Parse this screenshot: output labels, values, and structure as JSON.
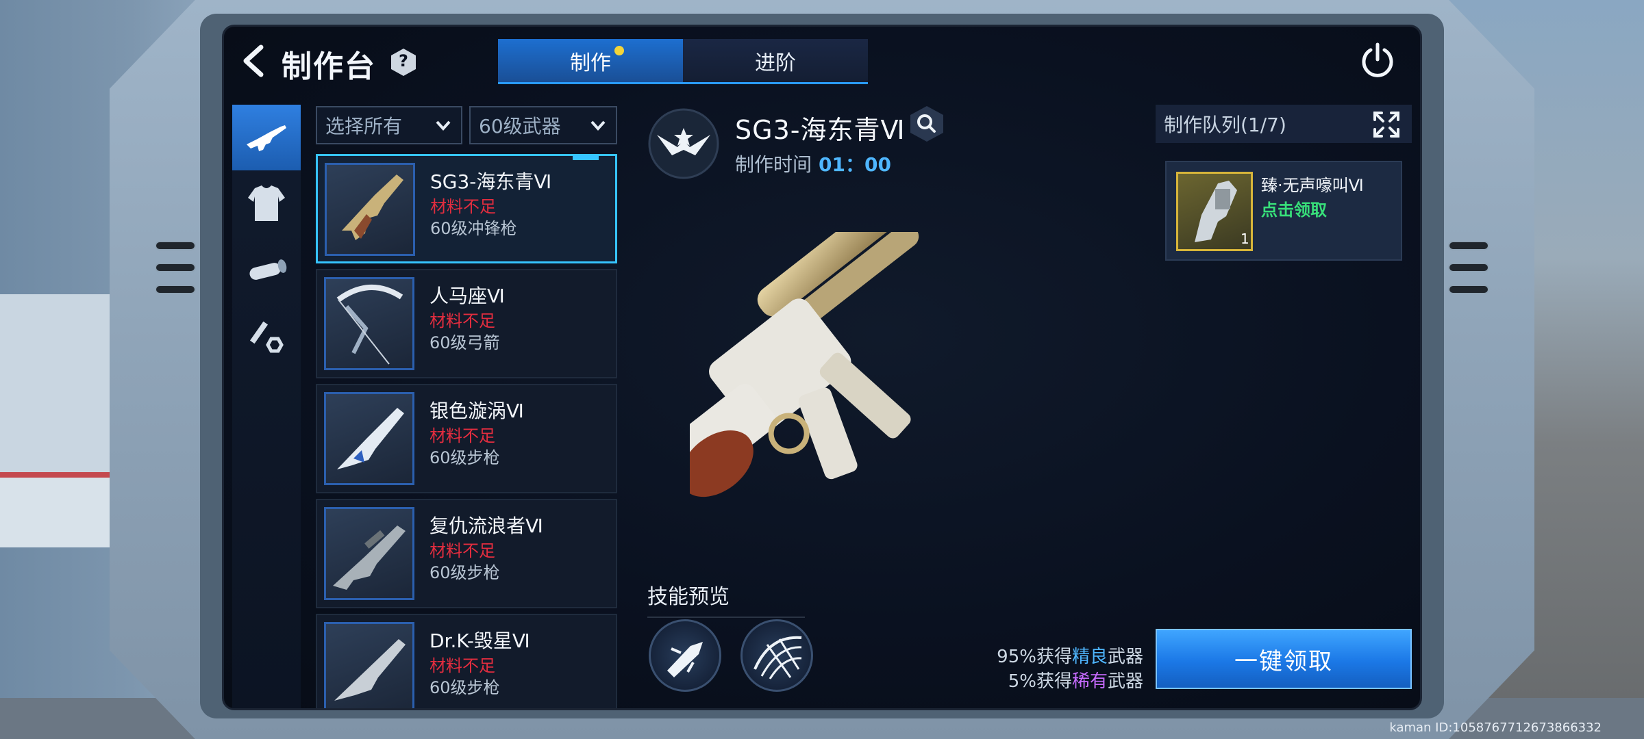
{
  "header": {
    "title": "制作台",
    "help_label": "?",
    "tabs": [
      {
        "label": "制作",
        "active": true,
        "has_notification": true
      },
      {
        "label": "进阶",
        "active": false,
        "has_notification": false
      }
    ]
  },
  "categories": [
    {
      "icon": "rifle-icon",
      "active": true
    },
    {
      "icon": "armor-icon",
      "active": false
    },
    {
      "icon": "scope-icon",
      "active": false
    },
    {
      "icon": "bolt-nut-icon",
      "active": false
    }
  ],
  "filters": {
    "type": "选择所有",
    "level": "60级武器"
  },
  "items": [
    {
      "name": "SG3-海东青Ⅵ",
      "status": "材料不足",
      "class": "60级冲锋枪",
      "selected": true
    },
    {
      "name": "人马座Ⅵ",
      "status": "材料不足",
      "class": "60级弓箭",
      "selected": false
    },
    {
      "name": "银色漩涡Ⅵ",
      "status": "材料不足",
      "class": "60级步枪",
      "selected": false
    },
    {
      "name": "复仇流浪者Ⅵ",
      "status": "材料不足",
      "class": "60级步枪",
      "selected": false
    },
    {
      "name": "Dr.K-毁星Ⅵ",
      "status": "材料不足",
      "class": "60级步枪",
      "selected": false
    }
  ],
  "detail": {
    "name": "SG3-海东青Ⅵ",
    "time_label": "制作时间",
    "time_value": "01：00",
    "skill_title": "技能预览"
  },
  "rates": {
    "line1_prefix": "95%获得",
    "line1_quality": "精良",
    "line1_suffix": "武器",
    "line2_prefix": "5%获得",
    "line2_quality": "稀有",
    "line2_suffix": "武器"
  },
  "collect_all_label": "一键领取",
  "queue": {
    "header": "制作队列(1/7)",
    "items": [
      {
        "name": "臻·无声嚎叫Ⅵ",
        "action": "点击领取",
        "qty": "1"
      }
    ]
  },
  "watermark": "kaman ID:1058767712673866332",
  "colors": {
    "accent": "#2a9bff",
    "warning": "#e32d3f",
    "claim": "#38e07a",
    "elite": "#4fb6ff",
    "rare": "#c86bff",
    "queue_frame": "#d7b53a"
  }
}
